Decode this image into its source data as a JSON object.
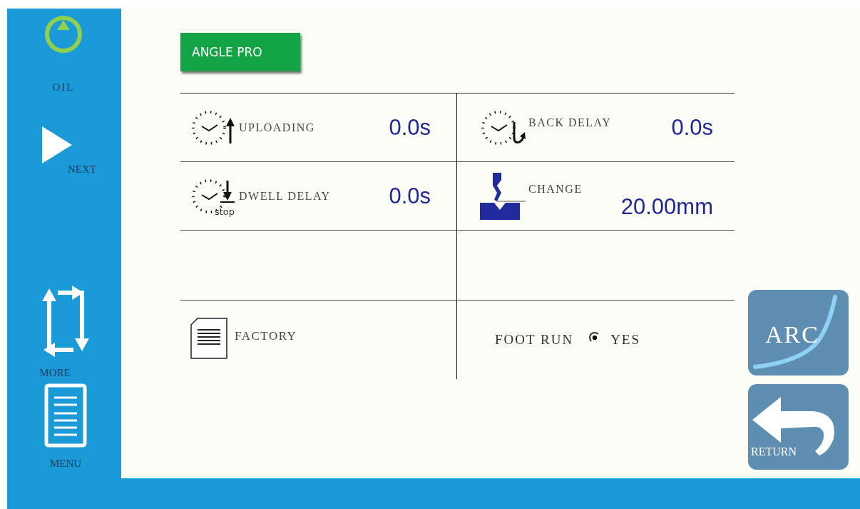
{
  "sidebar": {
    "items": [
      {
        "kind": "oil",
        "label": "OIL"
      },
      {
        "kind": "next",
        "label": "NEXT"
      },
      {
        "kind": "more",
        "label": "MORE"
      },
      {
        "kind": "menu",
        "label": "MENU"
      }
    ]
  },
  "mode_button": "ANGLE PRO",
  "params": [
    {
      "kind": "upload",
      "label": "UPLOADING",
      "value": "0.0s"
    },
    {
      "kind": "back",
      "label": "BACK DELAY",
      "value": "0.0s"
    },
    {
      "kind": "dwell",
      "sub": "stop",
      "label": "DWELL DELAY",
      "value": "0.0s"
    },
    {
      "kind": "press",
      "label": "CHANGE",
      "value": "20.00mm"
    }
  ],
  "factory": {
    "label": "FACTORY"
  },
  "foot_run": {
    "label": "FOOT RUN",
    "option": "YES",
    "selected": true
  },
  "side_buttons": [
    {
      "kind": "arc",
      "label": "ARC"
    },
    {
      "kind": "return",
      "label": "RETURN"
    }
  ]
}
